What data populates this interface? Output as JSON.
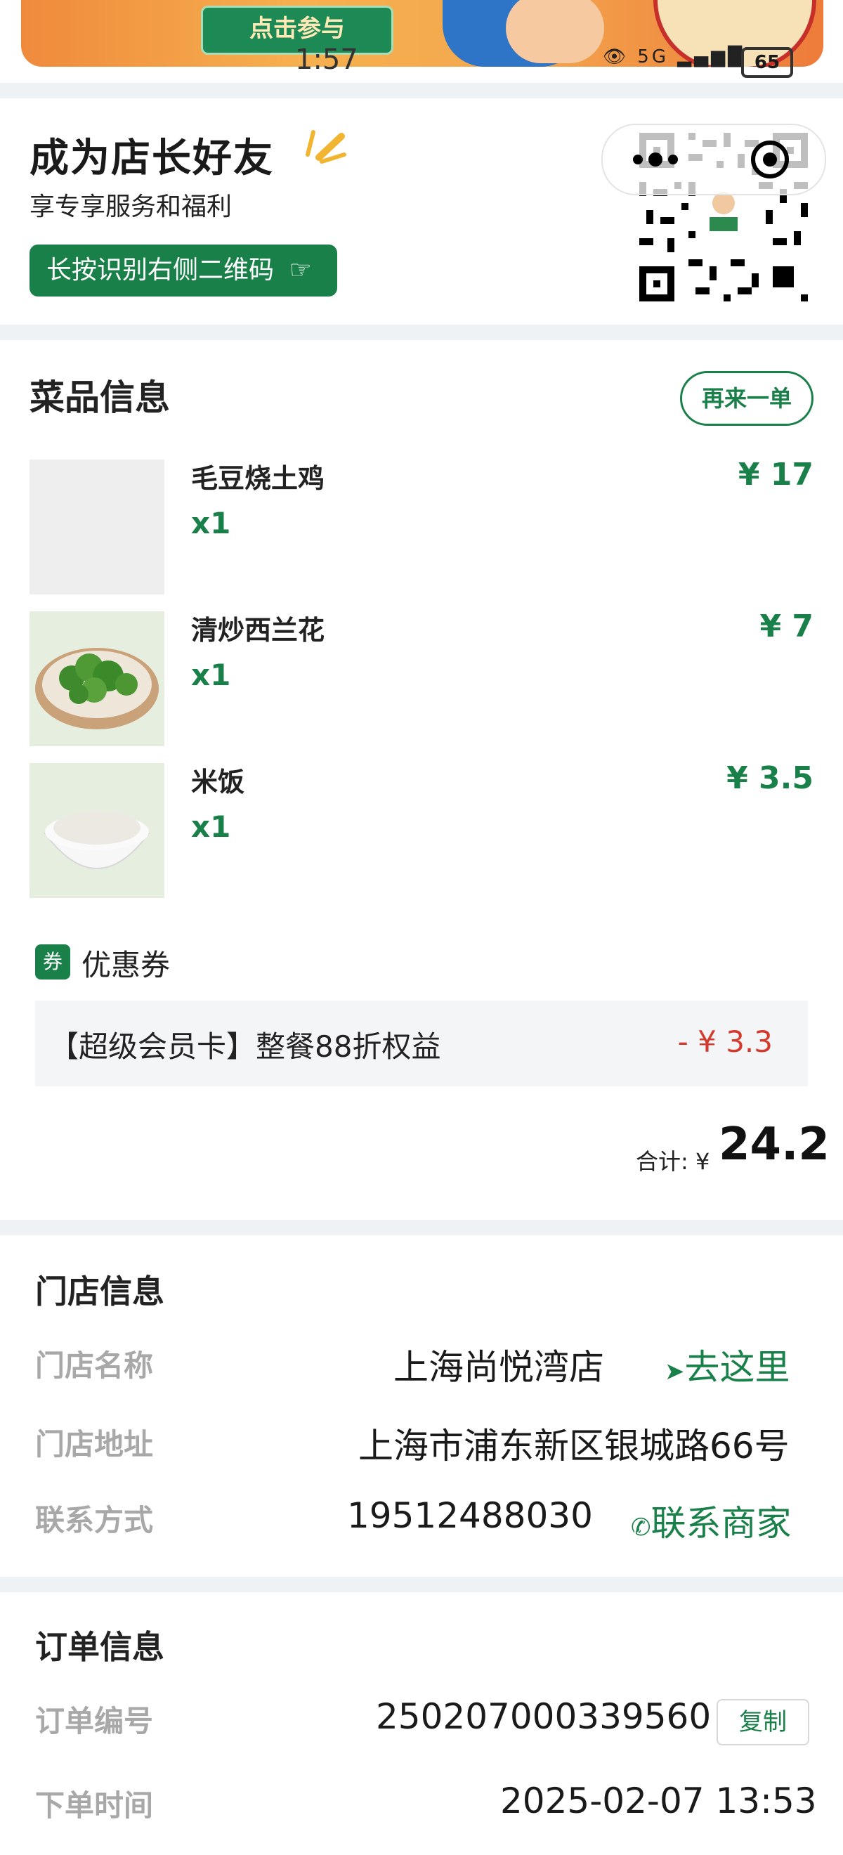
{
  "banner": {
    "cta_label": "点击参与"
  },
  "status_bar": {
    "time": "1:57",
    "network": "5G",
    "battery": "65"
  },
  "friend_card": {
    "title": "成为店长好友",
    "subtitle": "享专享服务和福利",
    "button_label": "长按识别右侧二维码"
  },
  "dishes": {
    "title": "菜品信息",
    "reorder_label": "再来一单",
    "items": [
      {
        "name": "毛豆烧土鸡",
        "qty": "x1",
        "price": "¥ 17"
      },
      {
        "name": "清炒西兰花",
        "qty": "x1",
        "price": "¥ 7"
      },
      {
        "name": "米饭",
        "qty": "x1",
        "price": "¥ 3.5"
      }
    ],
    "coupon": {
      "badge": "券",
      "label": "优惠券",
      "name": "【超级会员卡】整餐88折权益",
      "amount": "- ¥ 3.3"
    },
    "total": {
      "label": "合计: ¥",
      "value": "24.2"
    }
  },
  "store": {
    "title": "门店信息",
    "name_label": "门店名称",
    "name_value": "上海尚悦湾店",
    "navigate_label": "去这里",
    "address_label": "门店地址",
    "address_value": "上海市浦东新区银城路66号",
    "contact_label": "联系方式",
    "contact_value": "19512488030",
    "contact_link": "联系商家"
  },
  "order": {
    "title": "订单信息",
    "number_label": "订单编号",
    "number_value": "250207000339560",
    "copy_label": "复制",
    "time_label": "下单时间",
    "time_value": "2025-02-07 13:53"
  },
  "colors": {
    "accent": "#1a8049",
    "discount": "#d4392e",
    "label_gray": "#a8a8a8"
  }
}
